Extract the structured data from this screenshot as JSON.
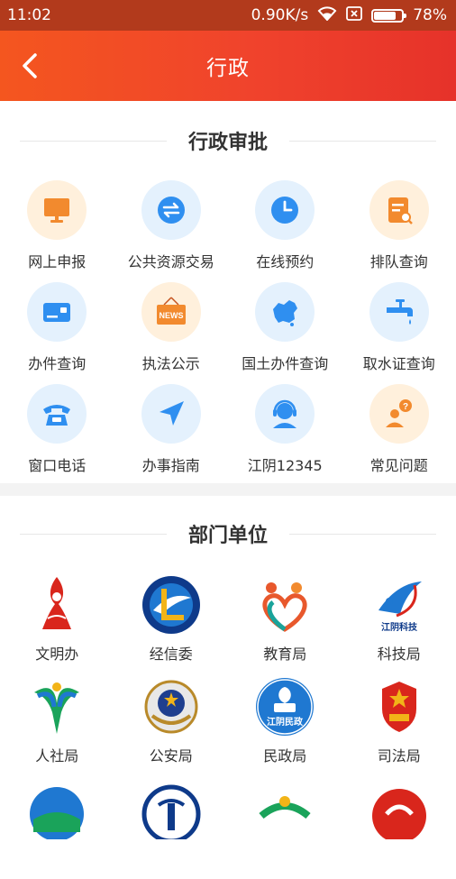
{
  "status": {
    "time": "11:02",
    "speed": "0.90K/s",
    "battery": "78%",
    "battery_level": 0.78
  },
  "header": {
    "title": "行政"
  },
  "section1": {
    "title": "行政审批",
    "items": [
      {
        "label": "网上申报",
        "icon": "monitor-icon",
        "bg": "#fff0dc"
      },
      {
        "label": "公共资源交易",
        "icon": "exchange-icon",
        "bg": "#e4f1fd"
      },
      {
        "label": "在线预约",
        "icon": "clock-icon",
        "bg": "#e4f1fd"
      },
      {
        "label": "排队查询",
        "icon": "clipboard-search-icon",
        "bg": "#fff0dc"
      },
      {
        "label": "办件查询",
        "icon": "card-icon",
        "bg": "#e4f1fd"
      },
      {
        "label": "执法公示",
        "icon": "news-board-icon",
        "bg": "#fff0dc"
      },
      {
        "label": "国土办件查询",
        "icon": "china-map-icon",
        "bg": "#e4f1fd"
      },
      {
        "label": "取水证查询",
        "icon": "faucet-icon",
        "bg": "#e4f1fd"
      },
      {
        "label": "窗口电话",
        "icon": "telephone-icon",
        "bg": "#e4f1fd"
      },
      {
        "label": "办事指南",
        "icon": "navigation-arrow-icon",
        "bg": "#e4f1fd"
      },
      {
        "label": "江阴12345",
        "icon": "customer-service-icon",
        "bg": "#e4f1fd"
      },
      {
        "label": "常见问题",
        "icon": "question-person-icon",
        "bg": "#fff0dc"
      }
    ]
  },
  "section2": {
    "title": "部门单位",
    "items": [
      {
        "label": "文明办",
        "icon": "civilization-office-logo"
      },
      {
        "label": "经信委",
        "icon": "economic-commission-logo"
      },
      {
        "label": "教育局",
        "icon": "education-bureau-logo"
      },
      {
        "label": "科技局",
        "icon": "science-bureau-logo",
        "logo_text": "江阴科技"
      },
      {
        "label": "人社局",
        "icon": "human-resources-logo"
      },
      {
        "label": "公安局",
        "icon": "police-emblem-logo"
      },
      {
        "label": "民政局",
        "icon": "civil-affairs-logo",
        "logo_text": "江阴民政"
      },
      {
        "label": "司法局",
        "icon": "justice-bureau-logo"
      },
      {
        "label": "",
        "icon": "environment-logo"
      },
      {
        "label": "",
        "icon": "blue-arch-logo"
      },
      {
        "label": "",
        "icon": "green-figure-logo"
      },
      {
        "label": "",
        "icon": "red-logo"
      }
    ]
  }
}
